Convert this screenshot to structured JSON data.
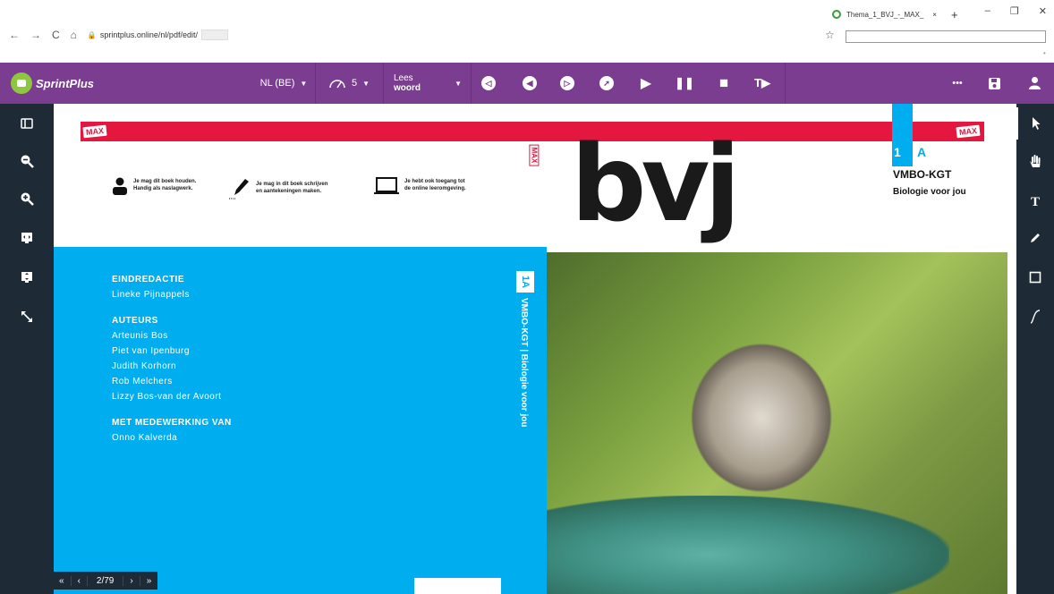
{
  "browser": {
    "tab_title": "Thema_1_BVJ_-_MAX_",
    "tab_close": "×",
    "new_tab": "+",
    "min": "–",
    "max": "❐",
    "close": "✕",
    "back": "←",
    "forward": "→",
    "reload": "C",
    "home": "⌂",
    "url": "sprintplus.online/nl/pdf/edit/",
    "lock": "🔒",
    "bookmark": "☆"
  },
  "toolbar": {
    "app_name": "SprintPlus",
    "language": "NL (BE)",
    "speed_value": "5",
    "read_mode_line1": "Lees",
    "read_mode_line2": "woord",
    "dropdown_arrow": "▼",
    "prev_label": "◁",
    "rewind_label": "◀",
    "skip_label": "▷",
    "pointer_label": "➚",
    "play": "▶",
    "pause": "❚❚",
    "stop": "■",
    "text_read": "T▶",
    "more": "•••",
    "save": "💾",
    "user": "👤"
  },
  "left_tools": [
    "◧",
    "🔍",
    "🔍",
    "⧉",
    "⬍",
    "↘"
  ],
  "right_tools": [
    "➤",
    "✋",
    "T",
    "✎",
    "□",
    "∫"
  ],
  "cover": {
    "max_label": "MAX",
    "level_number": "1",
    "level_letter": "A",
    "track": "VMBO-KGT",
    "subtitle": "Biologie voor jou",
    "title": "bvj",
    "features": [
      {
        "line1": "Je mag dit boek houden.",
        "line2": "Handig als naslagwerk."
      },
      {
        "line1": "Je mag in dit boek schrijven",
        "line2": "en aantekeningen maken."
      },
      {
        "line1": "Je hebt ook toegang tot",
        "line2": "de online leeromgeving."
      }
    ],
    "credits": {
      "editor_heading": "EINDREDACTIE",
      "editor": "Lineke Pijnappels",
      "authors_heading": "AUTEURS",
      "authors": [
        "Arteunis Bos",
        "Piet van Ipenburg",
        "Judith Korhorn",
        "Rob Melchers",
        "Lizzy Bos-van der Avoort"
      ],
      "contrib_heading": "MET MEDEWERKING VAN",
      "contributor": "Onno Kalverda"
    },
    "spine_number": "1A",
    "spine_text": "VMBO-KGT | Biologie voor jou"
  },
  "pager": {
    "first": "«",
    "prev": "‹",
    "current": "2/79",
    "next": "›",
    "last": "»"
  }
}
